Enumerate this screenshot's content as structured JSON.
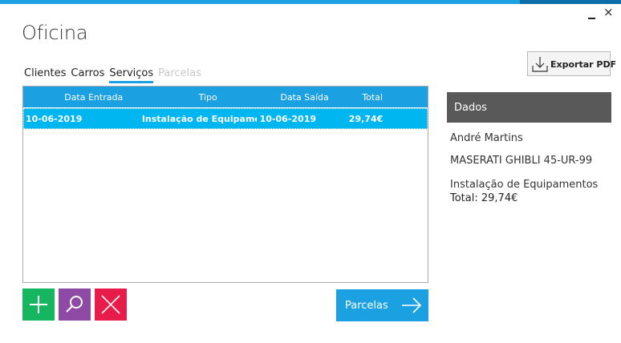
{
  "window": {
    "title": "Oficina",
    "minimize_label": "_",
    "close_label": "×"
  },
  "tabs": [
    {
      "label": "Clientes",
      "state": "normal"
    },
    {
      "label": "Carros",
      "state": "normal"
    },
    {
      "label": "Serviços",
      "state": "active"
    },
    {
      "label": "Parcelas",
      "state": "disabled"
    }
  ],
  "grid": {
    "columns": [
      "Data Entrada",
      "Tipo",
      "Data Saída",
      "Total"
    ],
    "rows": [
      {
        "data_entrada": "10-06-2019",
        "tipo": "Instalação de Equipame...",
        "data_saida": "10-06-2019",
        "total": "29,74€"
      }
    ]
  },
  "actions": {
    "add_icon": "plus-icon",
    "search_icon": "magnifier-icon",
    "delete_icon": "cross-icon",
    "parcelas_label": "Parcelas",
    "parcelas_icon": "arrow-right-icon"
  },
  "export": {
    "label": "Exportar PDF",
    "icon": "download-icon"
  },
  "details": {
    "header": "Dados",
    "client_name": "André Martins",
    "car": "MASERATI GHIBLI 45-UR-99",
    "service": "Instalação de Equipamentos",
    "total": "Total: 29,74€"
  },
  "colors": {
    "accent": "#1ba1e2",
    "selected_row": "#00b6f0",
    "add": "#16b560",
    "search": "#8e4aa5",
    "delete": "#e81c4a",
    "panel_header": "#595959"
  }
}
